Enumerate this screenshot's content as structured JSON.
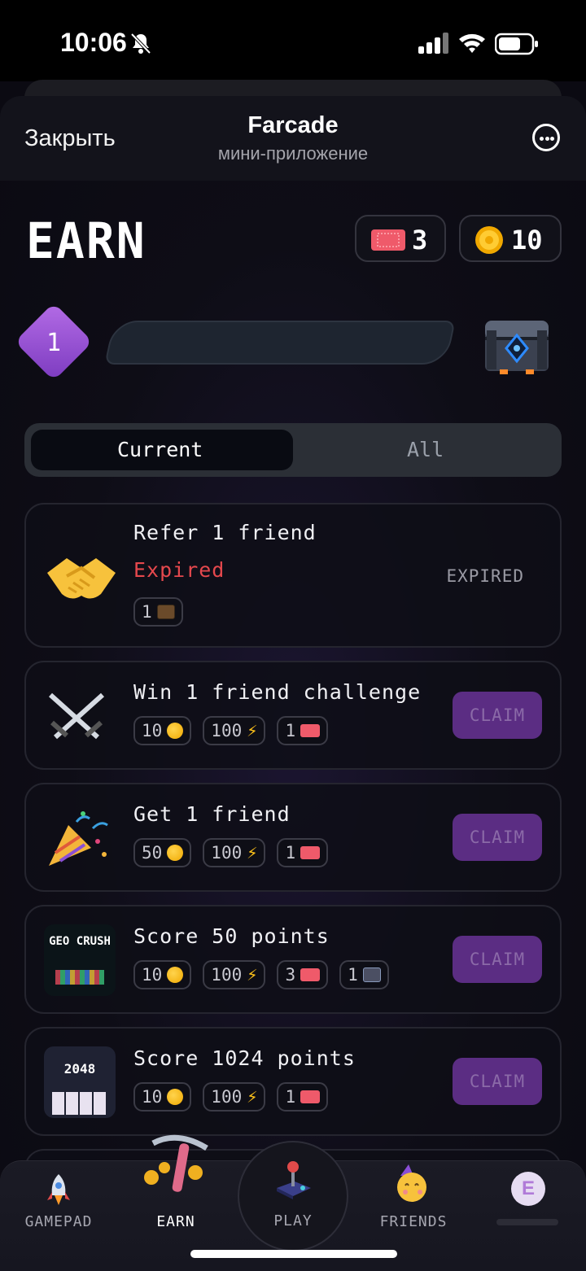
{
  "status_bar": {
    "time": "10:06"
  },
  "header": {
    "close_label": "Закрыть",
    "title": "Farcade",
    "subtitle": "мини-приложение"
  },
  "earn": {
    "title": "EARN",
    "tickets": "3",
    "coins": "10"
  },
  "level": {
    "number": "1",
    "progress": 0
  },
  "tabs": {
    "current": "Current",
    "all": "All",
    "selected": "Current"
  },
  "tasks": [
    {
      "title": "Refer 1 friend",
      "state_text": "Expired",
      "status": "EXPIRED",
      "rewards": [
        "1"
      ]
    },
    {
      "title": "Win 1 friend challenge",
      "button": "CLAIM",
      "rewards": [
        "10",
        "100",
        "1"
      ]
    },
    {
      "title": "Get 1 friend",
      "button": "CLAIM",
      "rewards": [
        "50",
        "100",
        "1"
      ]
    },
    {
      "title": "Score 50 points",
      "button": "CLAIM",
      "game_logo": "GEO CRUSH",
      "rewards": [
        "10",
        "100",
        "3",
        "1"
      ]
    },
    {
      "title": "Score 1024 points",
      "button": "CLAIM",
      "game_logo": "2048",
      "rewards": [
        "10",
        "100",
        "1"
      ]
    }
  ],
  "nav": {
    "gamepad": "GAMEPAD",
    "earn": "EARN",
    "play": "PLAY",
    "friends": "FRIENDS",
    "avatar_letter": "E",
    "active": "EARN"
  },
  "colors": {
    "accent_purple": "#5b2d83",
    "expired_red": "#e5484d",
    "coin_gold": "#f0a800"
  }
}
